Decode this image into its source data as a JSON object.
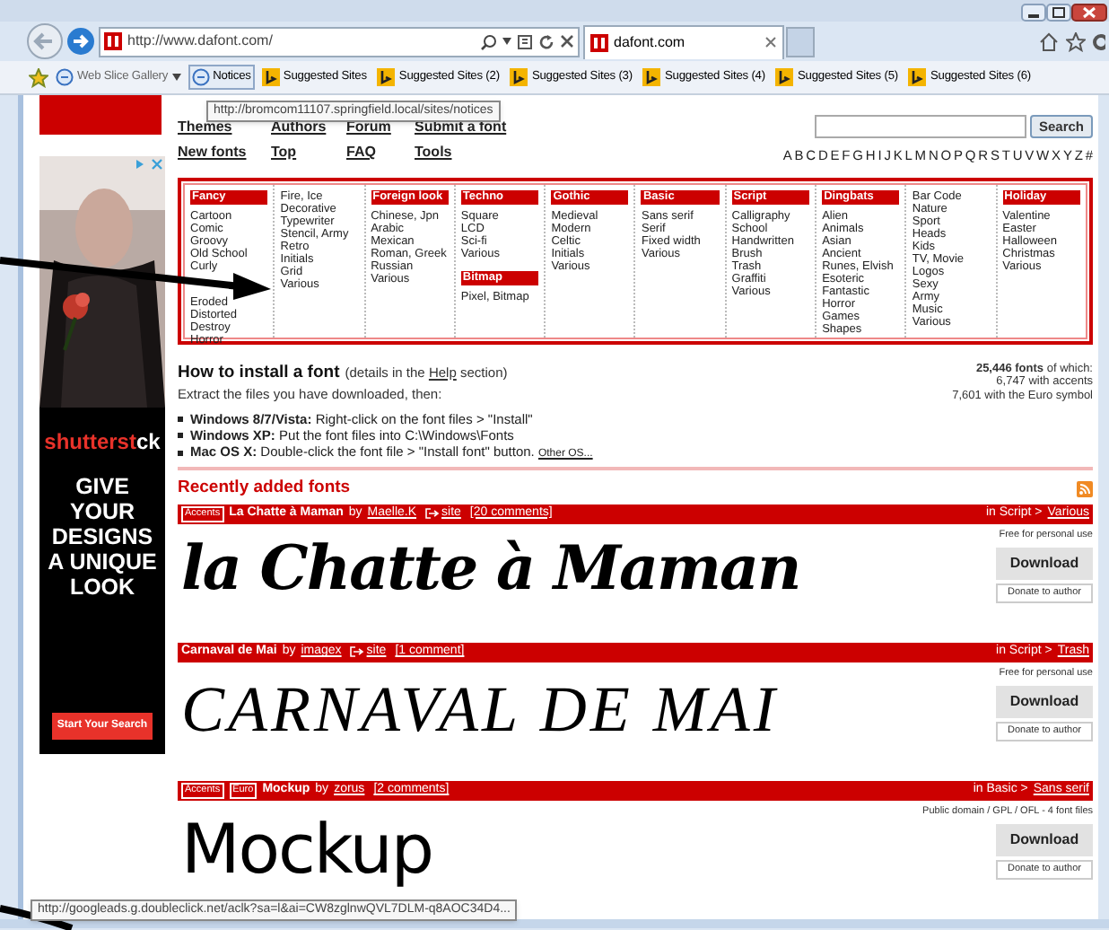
{
  "address_bar": {
    "url": "http://www.dafont.com/"
  },
  "tab": {
    "title": "dafont.com"
  },
  "favorites": [
    {
      "label": "Web Slice Gallery",
      "kind": "gallery",
      "hovered": false
    },
    {
      "label": "Notices",
      "kind": "page",
      "hovered": true
    },
    {
      "label": "Suggested Sites",
      "kind": "suggested",
      "hovered": false
    },
    {
      "label": "Suggested Sites (2)",
      "kind": "suggested",
      "hovered": false
    },
    {
      "label": "Suggested Sites (3)",
      "kind": "suggested",
      "hovered": false
    },
    {
      "label": "Suggested Sites (4)",
      "kind": "suggested",
      "hovered": false
    },
    {
      "label": "Suggested Sites (5)",
      "kind": "suggested",
      "hovered": false
    },
    {
      "label": "Suggested Sites (6)",
      "kind": "suggested",
      "hovered": false
    }
  ],
  "link_tooltip": "http://bromcom11107.springfield.local/sites/notices",
  "nav_links": [
    [
      "Themes",
      "Authors",
      "Forum",
      "Submit a font"
    ],
    [
      "New fonts",
      "Top",
      "FAQ",
      "Tools"
    ]
  ],
  "search": {
    "button": "Search"
  },
  "letters": [
    "A",
    "B",
    "C",
    "D",
    "E",
    "F",
    "G",
    "H",
    "I",
    "J",
    "K",
    "L",
    "M",
    "N",
    "O",
    "P",
    "Q",
    "R",
    "S",
    "T",
    "U",
    "V",
    "W",
    "X",
    "Y",
    "Z",
    "#"
  ],
  "ad": {
    "brand_start": "shutterst",
    "brand_end": "ck",
    "headline": "GIVE YOUR DESIGNS A UNIQUE LOOK",
    "button": "Start Your Search"
  },
  "categories": [
    [
      {
        "heading": "Fancy",
        "items": [
          "Cartoon",
          "Comic",
          "Groovy",
          "Old School",
          "Curly",
          "Eroded",
          "Distorted",
          "Destroy",
          "Horror"
        ]
      }
    ],
    [
      {
        "items": [
          "Fire, Ice",
          "Decorative",
          "Typewriter",
          "Stencil, Army",
          "Retro",
          "Initials",
          "Grid",
          "Various"
        ]
      }
    ],
    [
      {
        "heading": "Foreign look",
        "items": [
          "Chinese, Jpn",
          "Arabic",
          "Mexican",
          "Roman, Greek",
          "Russian",
          "Various"
        ]
      }
    ],
    [
      {
        "heading": "Techno",
        "items": [
          "Square",
          "LCD",
          "Sci-fi",
          "Various"
        ]
      },
      {
        "heading": "Bitmap",
        "items": [
          "Pixel, Bitmap"
        ]
      }
    ],
    [
      {
        "heading": "Gothic",
        "items": [
          "Medieval",
          "Modern",
          "Celtic",
          "Initials",
          "Various"
        ]
      }
    ],
    [
      {
        "heading": "Basic",
        "items": [
          "Sans serif",
          "Serif",
          "Fixed width",
          "Various"
        ]
      }
    ],
    [
      {
        "heading": "Script",
        "items": [
          "Calligraphy",
          "School",
          "Handwritten",
          "Brush",
          "Trash",
          "Graffiti",
          "Various"
        ]
      }
    ],
    [
      {
        "heading": "Dingbats",
        "items": [
          "Alien",
          "Animals",
          "Asian",
          "Ancient",
          "Runes, Elvish",
          "Esoteric",
          "Fantastic",
          "Horror",
          "Games",
          "Shapes"
        ]
      }
    ],
    [
      {
        "items": [
          "Bar Code",
          "Nature",
          "Sport",
          "Heads",
          "Kids",
          "TV, Movie",
          "Logos",
          "Sexy",
          "Army",
          "Music",
          "Various"
        ]
      }
    ],
    [
      {
        "heading": "Holiday",
        "items": [
          "Valentine",
          "Easter",
          "Halloween",
          "Christmas",
          "Various"
        ]
      }
    ]
  ],
  "install": {
    "title": "How to install a font",
    "note_before": "(details in the",
    "note_link": "Help",
    "note_after": "section)",
    "subtitle": "Extract the files you have downloaded, then:",
    "steps": [
      {
        "label": "Windows 8/7/Vista:",
        "text": "Right-click on the font files > \"Install\""
      },
      {
        "label": "Windows XP:",
        "text": "Put the font files into C:\\Windows\\Fonts"
      },
      {
        "label": "Mac OS X:",
        "text": "Double-click the font file > \"Install font\" button.",
        "link": "Other OS..."
      }
    ]
  },
  "stats": [
    "**25,446 fonts** of which:",
    "6,747 with accents",
    "7,601 with the Euro symbol"
  ],
  "recent": {
    "title": "Recently added fonts",
    "fonts": [
      {
        "tags": [
          "Accents"
        ],
        "name": "La Chatte à Maman",
        "by": "by",
        "author": "Maelle.K",
        "site": "site",
        "comments": "[20 comments]",
        "category": "in Script >",
        "subcategory": "Various",
        "license": "Free for personal use",
        "preview": "la Chatte à Maman",
        "kind": "script",
        "download": "Download",
        "donate": "Donate to author"
      },
      {
        "name": "Carnaval de Mai",
        "by": "by",
        "author": "imagex",
        "site": "site",
        "comments": "[1 comment]",
        "category": "in Script >",
        "subcategory": "Trash",
        "license": "Free for personal use",
        "preview": "CARNAVAL DE MAI",
        "kind": "brush",
        "download": "Download",
        "donate": "Donate to author"
      },
      {
        "tags": [
          "Accents",
          "Euro"
        ],
        "name": "Mockup",
        "by": "by",
        "author": "zorus",
        "comments": "[2 comments]",
        "category": "in Basic >",
        "subcategory": "Sans serif",
        "license": "Public domain / GPL / OFL - 4 font files",
        "preview": "Mockup",
        "kind": "sans",
        "download": "Download",
        "donate": "Donate to author"
      }
    ]
  },
  "status_url": "http://googleads.g.doubleclick.net/aclk?sa=l&ai=CW8zglnwQVL7DLM-q8AOC34D4..."
}
